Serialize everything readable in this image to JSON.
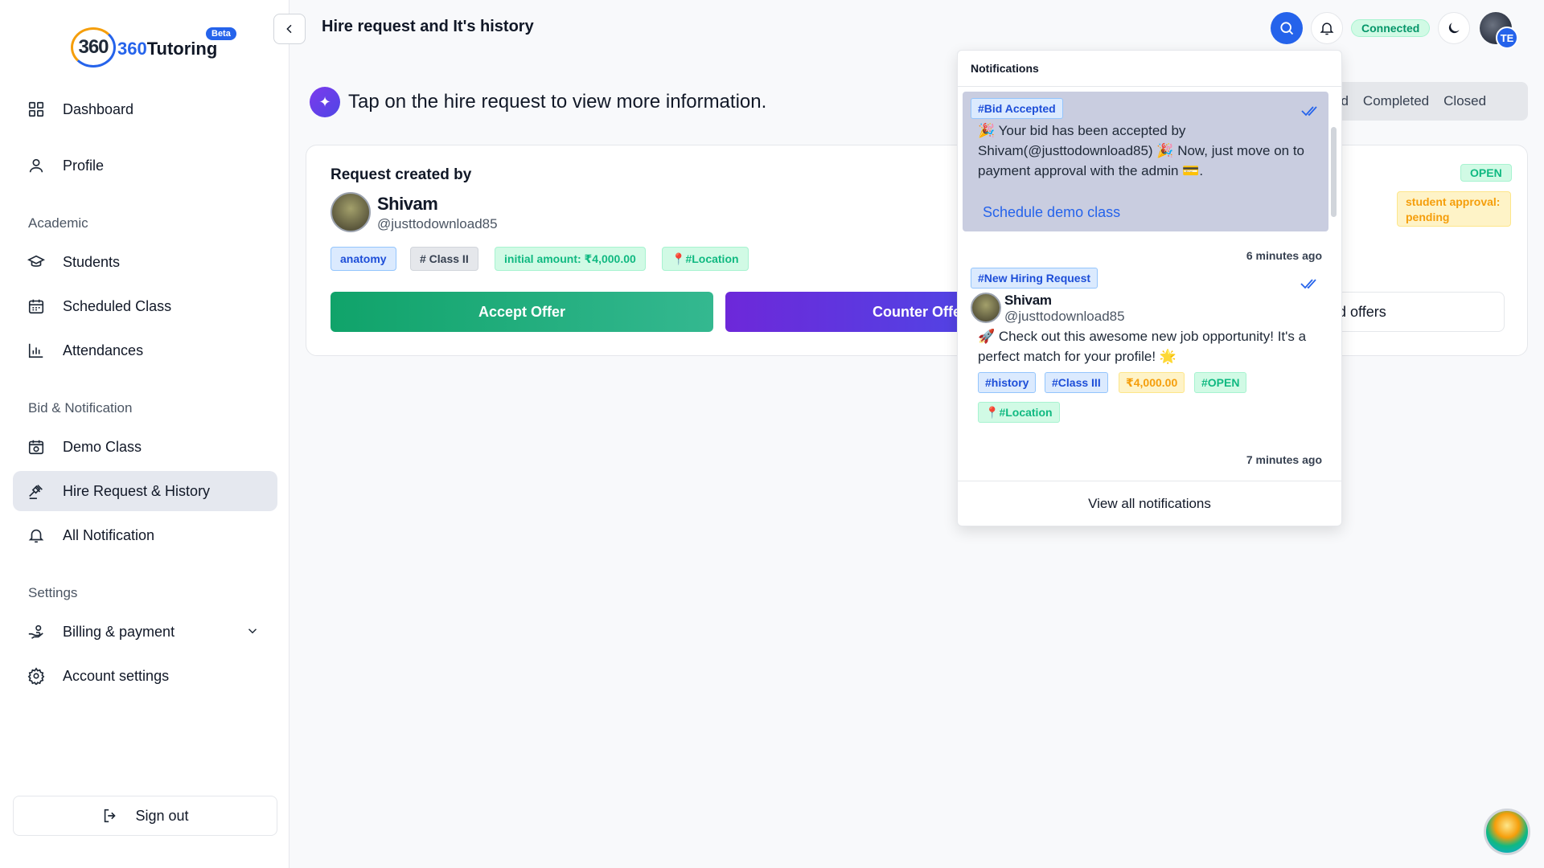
{
  "brand": {
    "name_num": "360",
    "name_text": "Tutoring",
    "mark": "360",
    "badge": "Beta"
  },
  "sidebar": {
    "items": [
      {
        "label": "Dashboard",
        "icon": "grid-icon"
      },
      {
        "label": "Profile",
        "icon": "user-icon"
      },
      {
        "label": "Students",
        "icon": "graduation-cap-icon"
      },
      {
        "label": "Scheduled Class",
        "icon": "calendar-icon"
      },
      {
        "label": "Attendances",
        "icon": "bar-chart-icon"
      },
      {
        "label": "Demo Class",
        "icon": "calendar-video-icon"
      },
      {
        "label": "Hire Request & History",
        "icon": "gavel-icon",
        "active": true
      },
      {
        "label": "All Notification",
        "icon": "bell-icon"
      },
      {
        "label": "Billing & payment",
        "icon": "hand-coin-icon"
      },
      {
        "label": "Account settings",
        "icon": "gear-icon"
      }
    ],
    "sections": {
      "academic": "Academic",
      "bid": "Bid & Notification",
      "settings": "Settings"
    },
    "signout": "Sign out"
  },
  "header": {
    "title": "Hire request and It's history",
    "status": "Connected",
    "avatar_initials": "TE"
  },
  "main": {
    "info": "Tap on the hire request to view more information.",
    "tabs": [
      "ed",
      "Completed",
      "Closed"
    ],
    "card": {
      "label": "Request created by",
      "name": "Shivam",
      "handle": "@justtodownload85",
      "tags": [
        "anatomy",
        "# Class II",
        "initial amount: ₹4,000.00",
        "#Location"
      ],
      "accept": "Accept Offer",
      "counter": "Counter Offer",
      "offers": "d offers",
      "status": "OPEN",
      "approval": "student approval: pending"
    }
  },
  "notifications": {
    "title": "Notifications",
    "items": [
      {
        "tag": "#Bid Accepted",
        "text": "🎉 Your bid has been accepted by Shivam(@justtodownload85) 🎉 Now, just move on to payment approval with the admin 💳.",
        "link": "Schedule demo class",
        "time": "6 minutes ago"
      },
      {
        "tag": "#New Hiring Request",
        "name": "Shivam",
        "handle": "@justtodownload85",
        "text": "🚀 Check out this awesome new job opportunity! It's a perfect match for your profile! 🌟",
        "tags": [
          "#history",
          "#Class III",
          "₹4,000.00",
          "#OPEN",
          "#Location"
        ],
        "time": "7 minutes ago"
      }
    ],
    "view_all": "View all notifications"
  }
}
